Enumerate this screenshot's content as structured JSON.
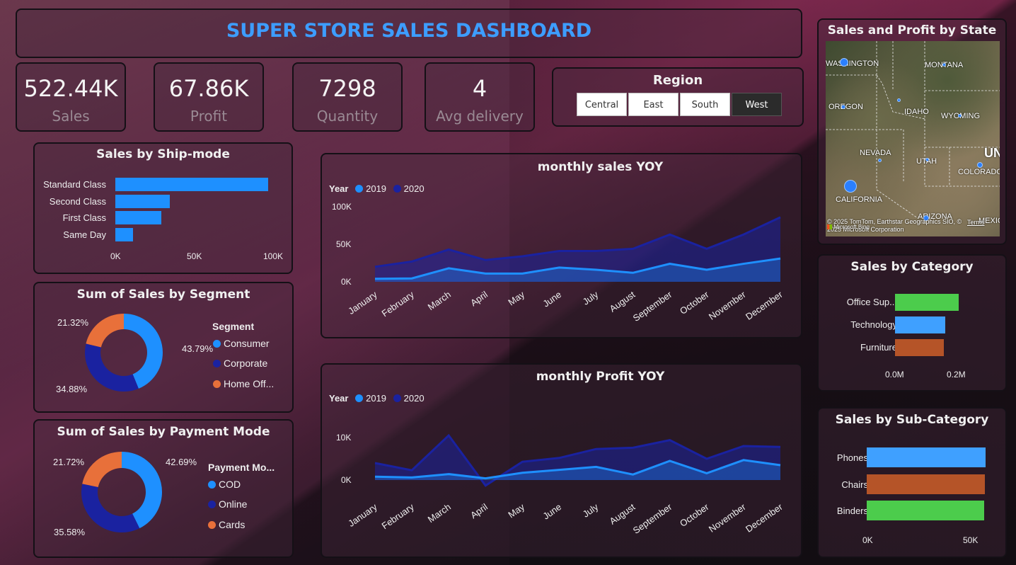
{
  "title": "SUPER STORE SALES DASHBOARD",
  "kpis": [
    {
      "value": "522.44K",
      "label": "Sales"
    },
    {
      "value": "67.86K",
      "label": "Profit"
    },
    {
      "value": "7298",
      "label": "Quantity"
    },
    {
      "value": "4",
      "label": "Avg delivery"
    }
  ],
  "region": {
    "title": "Region",
    "options": [
      "Central",
      "East",
      "South",
      "West"
    ],
    "selected": "West"
  },
  "ship_mode": {
    "title": "Sales by Ship-mode",
    "categories": [
      "Standard Class",
      "Second Class",
      "First Class",
      "Same Day"
    ],
    "ticks": [
      "0K",
      "50K",
      "100K"
    ]
  },
  "segment": {
    "title": "Sum of Sales by Segment",
    "legend_title": "Segment",
    "items": [
      {
        "label": "Consumer",
        "pct": "43.79%"
      },
      {
        "label": "Corporate",
        "pct": "34.88%"
      },
      {
        "label": "Home Off...",
        "pct": "21.32%"
      }
    ]
  },
  "payment": {
    "title": "Sum of Sales by Payment Mode",
    "legend_title": "Payment Mo...",
    "items": [
      {
        "label": "COD",
        "pct": "42.69%"
      },
      {
        "label": "Online",
        "pct": "35.58%"
      },
      {
        "label": "Cards",
        "pct": "21.72%"
      }
    ]
  },
  "sales_yoy": {
    "title": "monthly sales YOY",
    "legend_label": "Year",
    "series_names": [
      "2019",
      "2020"
    ],
    "yticks": [
      "100K",
      "50K",
      "0K"
    ]
  },
  "profit_yoy": {
    "title": "monthly Profit YOY",
    "legend_label": "Year",
    "series_names": [
      "2019",
      "2020"
    ],
    "yticks": [
      "10K",
      "0K"
    ]
  },
  "months": [
    "January",
    "February",
    "March",
    "April",
    "May",
    "June",
    "July",
    "August",
    "September",
    "October",
    "November",
    "December"
  ],
  "map": {
    "title": "Sales and Profit by State",
    "labels": [
      "WASHINGTON",
      "MONTANA",
      "OREGON",
      "IDAHO",
      "WYOMING",
      "NEVADA",
      "UTAH",
      "UN",
      "COLORADO",
      "CALIFORNIA",
      "ARIZONA",
      "MEXICO"
    ],
    "credit": "© 2025 TomTom, Earthstar Geographics SIO, © 2025 Microsoft Corporation",
    "terms": "Terms",
    "brand": "Microsoft Bing"
  },
  "category": {
    "title": "Sales by Category",
    "categories": [
      "Office Sup...",
      "Technology",
      "Furniture"
    ],
    "ticks": [
      "0.0M",
      "0.2M"
    ]
  },
  "subcategory": {
    "title": "Sales by Sub-Category",
    "categories": [
      "Phones",
      "Chairs",
      "Binders"
    ],
    "ticks": [
      "0K",
      "50K"
    ]
  },
  "colors": {
    "blue": "#1e90ff",
    "darkblue": "#1a22a0",
    "orange": "#e8703a",
    "green": "#4ccc4c",
    "lightblue": "#3fa0ff",
    "brown": "#b55428",
    "title_blue": "#3d9dff"
  },
  "chart_data": [
    {
      "type": "bar",
      "title": "Sales by Ship-mode",
      "categories": [
        "Standard Class",
        "Second Class",
        "First Class",
        "Same Day"
      ],
      "values": [
        96000,
        34000,
        29000,
        11000
      ],
      "xlim": [
        0,
        100000
      ]
    },
    {
      "type": "pie",
      "title": "Sum of Sales by Segment",
      "categories": [
        "Consumer",
        "Corporate",
        "Home Off..."
      ],
      "values": [
        43.79,
        34.88,
        21.32
      ]
    },
    {
      "type": "pie",
      "title": "Sum of Sales by Payment Mode",
      "categories": [
        "COD",
        "Online",
        "Cards"
      ],
      "values": [
        42.69,
        35.58,
        21.72
      ]
    },
    {
      "type": "area",
      "title": "monthly sales YOY",
      "x": [
        "January",
        "February",
        "March",
        "April",
        "May",
        "June",
        "July",
        "August",
        "September",
        "October",
        "November",
        "December"
      ],
      "series": [
        {
          "name": "2019",
          "values": [
            4000,
            4500,
            18000,
            11000,
            11000,
            19000,
            16000,
            12000,
            24000,
            16000,
            24000,
            31000
          ]
        },
        {
          "name": "2020",
          "values": [
            20000,
            27000,
            43000,
            29000,
            34000,
            41000,
            41000,
            44000,
            63000,
            44000,
            63000,
            86000
          ]
        }
      ],
      "ylim": [
        0,
        100000
      ]
    },
    {
      "type": "area",
      "title": "monthly Profit YOY",
      "x": [
        "January",
        "February",
        "March",
        "April",
        "May",
        "June",
        "July",
        "August",
        "September",
        "October",
        "November",
        "December"
      ],
      "series": [
        {
          "name": "2019",
          "values": [
            800,
            600,
            1400,
            400,
            1700,
            2400,
            3100,
            1300,
            4500,
            1600,
            4700,
            3500
          ]
        },
        {
          "name": "2020",
          "values": [
            4000,
            2300,
            10500,
            -1300,
            4300,
            5200,
            7300,
            7600,
            9400,
            5000,
            8000,
            7800
          ]
        }
      ],
      "ylim": [
        -2000,
        12000
      ]
    },
    {
      "type": "bar",
      "title": "Sales by Category",
      "categories": [
        "Office Sup...",
        "Technology",
        "Furniture"
      ],
      "values": [
        190000,
        150000,
        145000
      ],
      "xlim": [
        0,
        300000
      ]
    },
    {
      "type": "bar",
      "title": "Sales by Sub-Category",
      "categories": [
        "Phones",
        "Chairs",
        "Binders"
      ],
      "values": [
        68000,
        67500,
        67000
      ],
      "xlim": [
        0,
        55000
      ]
    }
  ]
}
